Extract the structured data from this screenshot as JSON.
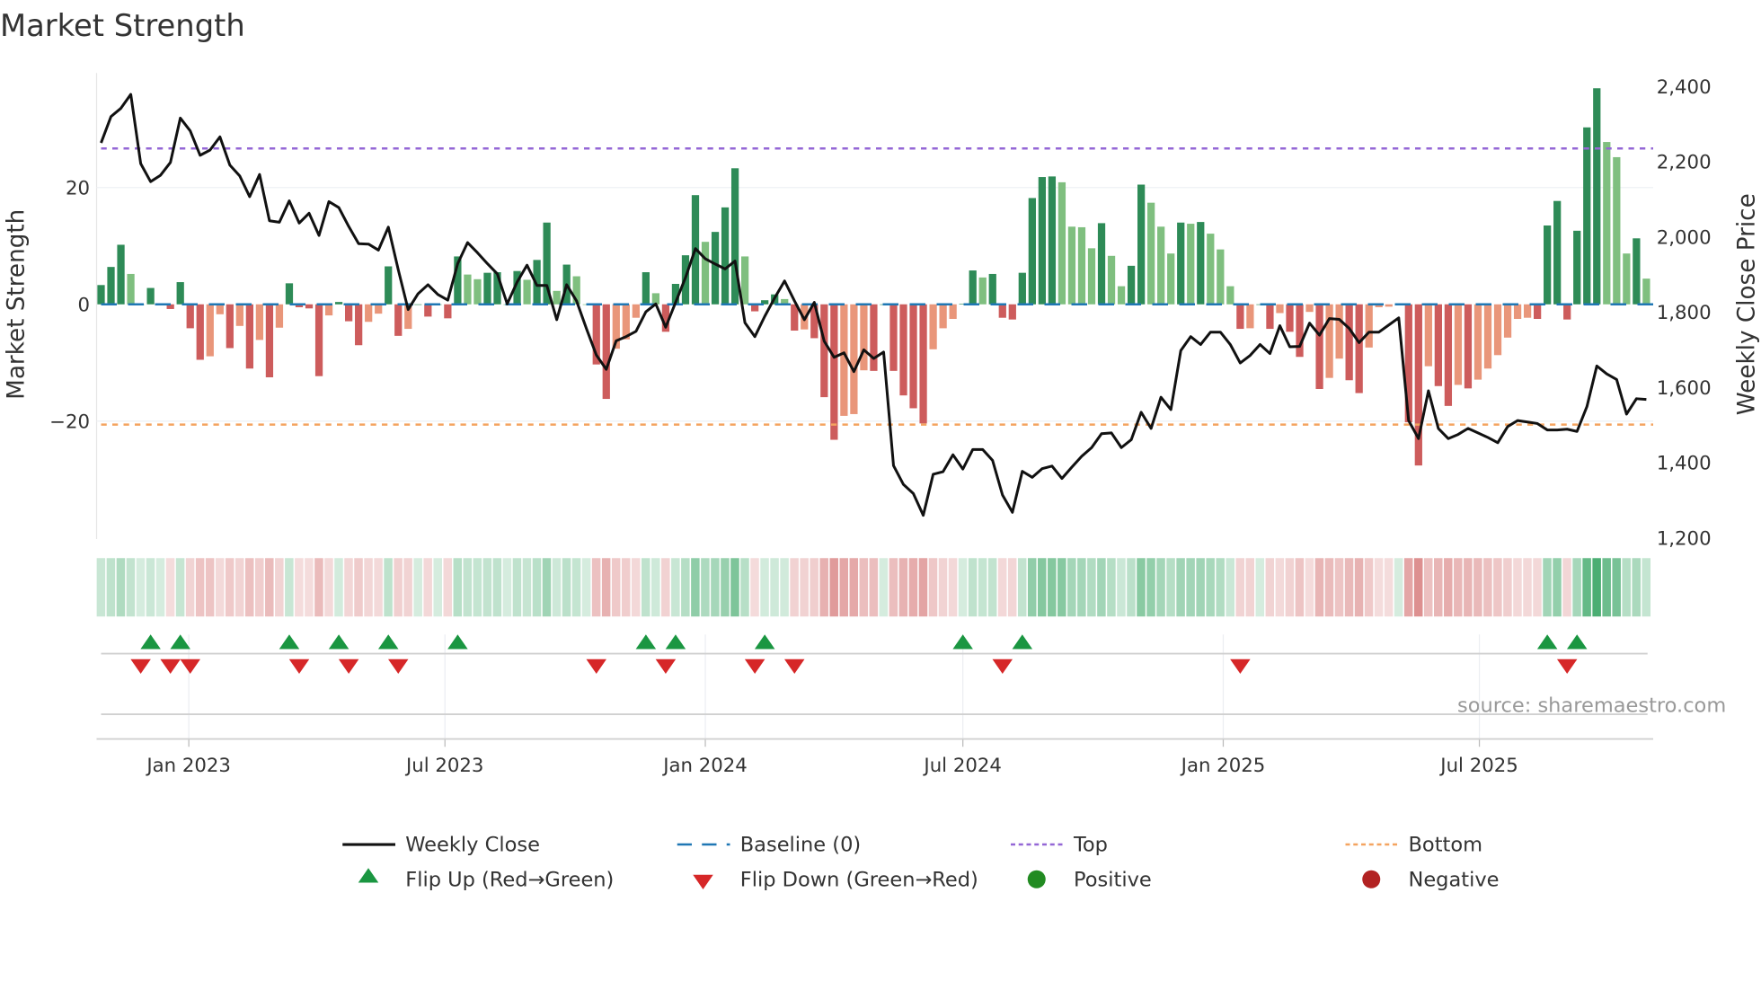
{
  "chart_data": {
    "type": "bar+line",
    "title": "Market Strength",
    "ylabel": "Market Strength",
    "y2label": "Weekly Close Price",
    "source": "source: sharemaestro.com",
    "x_start": "2022-10-31",
    "x_interval_days": 7,
    "ylim": [
      -40,
      40
    ],
    "y2lim": [
      1200,
      2400
    ],
    "yticks": [
      {
        "v": 20,
        "label": "20"
      },
      {
        "v": 0,
        "label": "0"
      },
      {
        "v": -20,
        "label": "−20"
      }
    ],
    "y2ticks": [
      {
        "v": 2400,
        "label": "2,400"
      },
      {
        "v": 2200,
        "label": "2,200"
      },
      {
        "v": 2000,
        "label": "2,000"
      },
      {
        "v": 1800,
        "label": "1,800"
      },
      {
        "v": 1600,
        "label": "1,600"
      },
      {
        "v": 1400,
        "label": "1,400"
      },
      {
        "v": 1200,
        "label": "1,200"
      }
    ],
    "xticks": [
      {
        "date": "2023-01-01",
        "label": "Jan 2023"
      },
      {
        "date": "2023-07-01",
        "label": "Jul 2023"
      },
      {
        "date": "2024-01-01",
        "label": "Jan 2024"
      },
      {
        "date": "2024-07-01",
        "label": "Jul 2024"
      },
      {
        "date": "2025-01-01",
        "label": "Jan 2025"
      },
      {
        "date": "2025-07-01",
        "label": "Jul 2025"
      }
    ],
    "top_level": 26.7,
    "bottom_level": -20.6,
    "baseline": 0,
    "strength": [
      3.3,
      6.4,
      10.2,
      5.2,
      0,
      2.8,
      0,
      -0.8,
      3.8,
      -4.1,
      -9.5,
      -8.9,
      -1.7,
      -7.5,
      -3.7,
      -11,
      -6.1,
      -12.5,
      -4,
      3.6,
      -0.5,
      -0.7,
      -12.3,
      -1.9,
      0.4,
      -2.9,
      -7,
      -3,
      -1.6,
      6.5,
      -5.4,
      -4.2,
      0,
      -2.1,
      0,
      -2.4,
      8.2,
      5.1,
      4.3,
      5.4,
      5.5,
      0,
      5.7,
      4.2,
      7.6,
      14,
      2.3,
      6.8,
      4.8,
      0,
      -10.3,
      -16.2,
      -7.6,
      -6,
      -2.3,
      5.5,
      1.9,
      -4.7,
      3.5,
      8.4,
      18.7,
      10.7,
      12.4,
      16.6,
      23.3,
      8.2,
      -1.2,
      0.7,
      1.7,
      0.9,
      -4.5,
      -4.3,
      -5.8,
      -15.9,
      -23.2,
      -19.1,
      -18.8,
      -11.3,
      -11.4,
      0,
      -11.4,
      -15.6,
      -17.8,
      -20.4,
      -7.7,
      -4.1,
      -2.5,
      0.1,
      5.8,
      4.6,
      5.2,
      -2.3,
      -2.6,
      5.4,
      18.2,
      21.8,
      21.9,
      20.9,
      13.3,
      13.2,
      9.6,
      13.9,
      8.3,
      3.1,
      6.6,
      20.5,
      17.4,
      13.3,
      8.7,
      14,
      13.8,
      14.1,
      12.1,
      9.4,
      3.1,
      -4.2,
      -4.1,
      0,
      -4.2,
      -1.5,
      -4.7,
      -9,
      -1.3,
      -14.5,
      -12.6,
      -9.3,
      -13,
      -15.2,
      -7.4,
      -0.5,
      -0.4,
      0,
      -20.2,
      -27.6,
      -10.6,
      -14,
      -17.4,
      -13.8,
      -14.4,
      -12.9,
      -11,
      -8.7,
      -5.7,
      -2.5,
      -2.3,
      -2.5,
      13.5,
      17.7,
      -2.6,
      12.6,
      30.3,
      37,
      27.8,
      25.2,
      8.7,
      11.3,
      4.4
    ],
    "weekly_close": [
      2250,
      2320,
      2342,
      2379,
      2195,
      2147,
      2164,
      2198,
      2316,
      2282,
      2217,
      2231,
      2266,
      2191,
      2162,
      2107,
      2166,
      2043,
      2039,
      2096,
      2037,
      2063,
      2004,
      2094,
      2078,
      2028,
      1982,
      1981,
      1965,
      2026,
      1913,
      1807,
      1849,
      1873,
      1847,
      1832,
      1929,
      1985,
      1958,
      1929,
      1902,
      1822,
      1880,
      1925,
      1871,
      1871,
      1780,
      1873,
      1830,
      1756,
      1686,
      1648,
      1724,
      1735,
      1749,
      1801,
      1822,
      1760,
      1826,
      1892,
      1969,
      1942,
      1928,
      1915,
      1936,
      1772,
      1735,
      1789,
      1838,
      1883,
      1830,
      1780,
      1826,
      1723,
      1680,
      1692,
      1642,
      1700,
      1677,
      1694,
      1392,
      1342,
      1318,
      1260,
      1369,
      1376,
      1421,
      1383,
      1435,
      1435,
      1406,
      1314,
      1268,
      1377,
      1361,
      1384,
      1391,
      1358,
      1388,
      1417,
      1440,
      1477,
      1479,
      1440,
      1461,
      1534,
      1491,
      1574,
      1541,
      1698,
      1735,
      1714,
      1747,
      1747,
      1714,
      1665,
      1685,
      1714,
      1690,
      1764,
      1708,
      1709,
      1771,
      1739,
      1783,
      1781,
      1757,
      1719,
      1747,
      1747,
      1766,
      1785,
      1512,
      1464,
      1591,
      1491,
      1464,
      1475,
      1491,
      1479,
      1467,
      1453,
      1496,
      1512,
      1508,
      1504,
      1487,
      1487,
      1489,
      1483,
      1549,
      1657,
      1636,
      1621,
      1529,
      1570,
      1568
    ],
    "flip_up_indices": [
      5,
      8,
      19,
      24,
      29,
      36,
      55,
      58,
      67,
      87,
      93,
      146,
      149
    ],
    "flip_down_indices": [
      4,
      7,
      9,
      20,
      25,
      30,
      50,
      57,
      66,
      70,
      91,
      115,
      148
    ],
    "legend": {
      "placement": "bottom",
      "items": [
        {
          "key": "close",
          "label": "Weekly Close"
        },
        {
          "key": "baseline",
          "label": "Baseline (0)"
        },
        {
          "key": "top",
          "label": "Top"
        },
        {
          "key": "bottom",
          "label": "Bottom"
        },
        {
          "key": "up",
          "label": "Flip Up (Red→Green)"
        },
        {
          "key": "down",
          "label": "Flip Down (Green→Red)"
        },
        {
          "key": "pos",
          "label": "Positive"
        },
        {
          "key": "neg",
          "label": "Negative"
        }
      ]
    },
    "colors": {
      "pos_rising": "#2e8b57",
      "pos_falling": "#7fbf7f",
      "neg_falling": "#cd5c5c",
      "neg_rising": "#e9967a",
      "close": "#111111",
      "baseline": "#1f77b4",
      "top": "#9467d6",
      "bottom": "#f4a460",
      "flip_up": "#1a9641",
      "flip_down": "#d62728",
      "positive": "#228b22",
      "negative": "#b22222",
      "strip_pos": "#2ca05a",
      "strip_neg": "#cd5c5c"
    }
  }
}
